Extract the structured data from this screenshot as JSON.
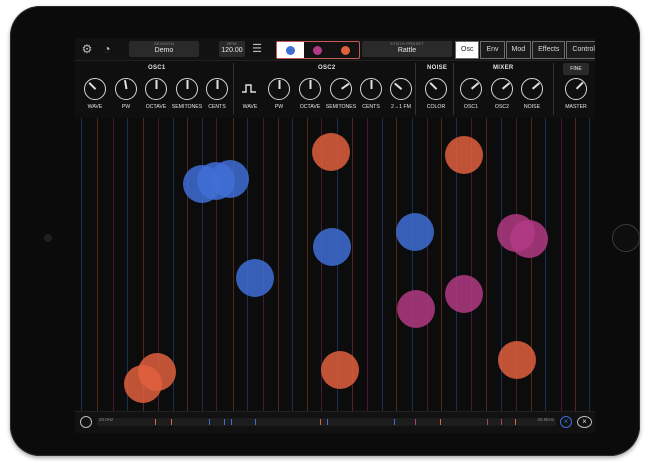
{
  "header": {
    "session_caption": "SESSION",
    "session_value": "Demo",
    "bpm_caption": "BPM",
    "bpm_value": "120.00",
    "preset_caption": "SYNTH PRESET",
    "preset_value": "Rattle",
    "voices": [
      {
        "color": "#3f6fd6"
      },
      {
        "color": "#b23a84"
      },
      {
        "color": "#e0603d"
      }
    ],
    "tabs": [
      "Osc",
      "Env",
      "Mod",
      "Effects",
      "Control"
    ],
    "active_tab": "Osc"
  },
  "sections": {
    "osc1": "OSC1",
    "osc2": "OSC2",
    "noise": "NOISE",
    "mixer": "MIXER",
    "fine": "FINE"
  },
  "knobs": {
    "osc1": [
      "WAVE",
      "PW",
      "OCTAVE",
      "SEMITONES",
      "CENTS"
    ],
    "osc2": [
      "WAVE",
      "PW",
      "OCTAVE",
      "SEMITONES",
      "CENTS",
      "2→1 FM"
    ],
    "noise": [
      "COLOR"
    ],
    "mixer": [
      "OSC1",
      "OSC2",
      "NOISE"
    ],
    "master": "MASTER"
  },
  "keyboard": {
    "left_label": "20.0Hz",
    "right_label": "20.0kHz"
  },
  "colors": {
    "blue": "#3f6fd6",
    "magenta": "#b23a84",
    "orange": "#e0603d"
  }
}
